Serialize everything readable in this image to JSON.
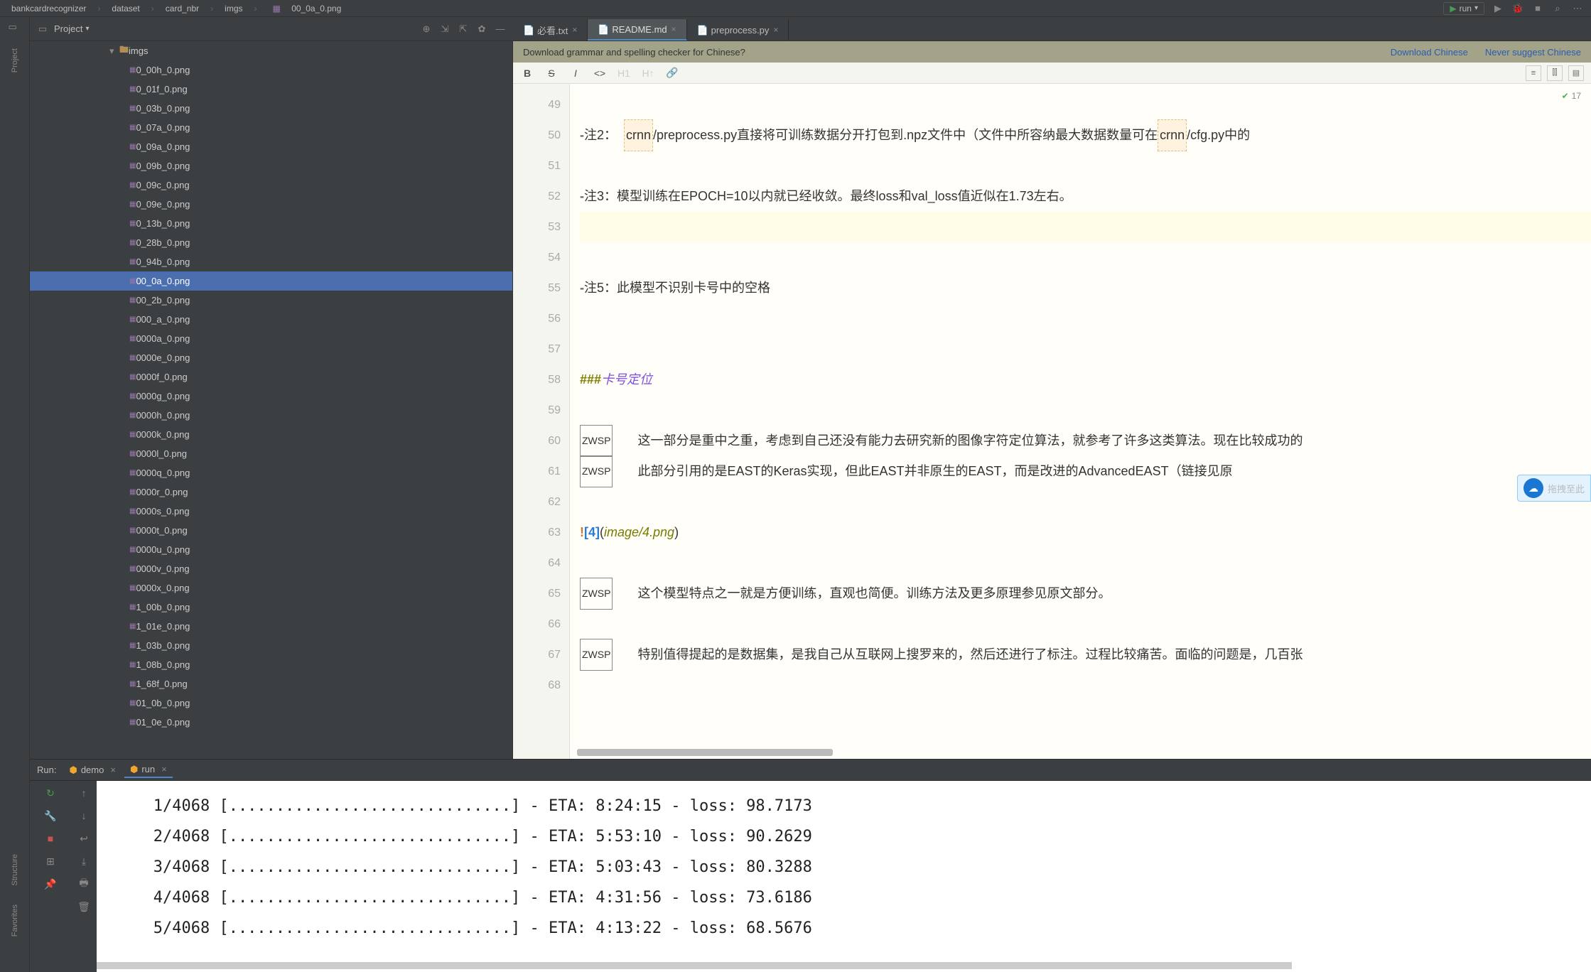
{
  "breadcrumb": [
    "bankcardrecognizer",
    "dataset",
    "card_nbr",
    "imgs",
    "00_0a_0.png"
  ],
  "run_config": "run",
  "project_label": "Project",
  "tree": {
    "folder": "imgs",
    "files": [
      "0_00h_0.png",
      "0_01f_0.png",
      "0_03b_0.png",
      "0_07a_0.png",
      "0_09a_0.png",
      "0_09b_0.png",
      "0_09c_0.png",
      "0_09e_0.png",
      "0_13b_0.png",
      "0_28b_0.png",
      "0_94b_0.png",
      "00_0a_0.png",
      "00_2b_0.png",
      "000_a_0.png",
      "0000a_0.png",
      "0000e_0.png",
      "0000f_0.png",
      "0000g_0.png",
      "0000h_0.png",
      "0000k_0.png",
      "0000l_0.png",
      "0000q_0.png",
      "0000r_0.png",
      "0000s_0.png",
      "0000t_0.png",
      "0000u_0.png",
      "0000v_0.png",
      "0000x_0.png",
      "1_00b_0.png",
      "1_01e_0.png",
      "1_03b_0.png",
      "1_08b_0.png",
      "1_68f_0.png",
      "01_0b_0.png",
      "01_0e_0.png"
    ],
    "selected": "00_0a_0.png"
  },
  "tabs": [
    {
      "label": "必看.txt",
      "active": false
    },
    {
      "label": "README.md",
      "active": true
    },
    {
      "label": "preprocess.py",
      "active": false
    }
  ],
  "banner": {
    "text": "Download grammar and spelling checker for Chinese?",
    "link1": "Download Chinese",
    "link2": "Never suggest Chinese"
  },
  "inspection_count": "17",
  "lines": {
    "start": 49,
    "end": 68,
    "l50_pre": "- 注2：  ",
    "l50_crnn": "crnn",
    "l50_mid": "/preprocess.py直接将可训练数据分开打包到.npz文件中（文件中所容纳最大数据数量可在",
    "l50_crnn2": "crnn",
    "l50_end": "/cfg.py中的",
    "l52": "- 注3：模型训练在EPOCH=10以内就已经收敛。最终loss和val_loss值近似在1.73左右。",
    "l55": "- 注5：此模型不识别卡号中的空格",
    "l58_h": "###",
    "l58_t": " 卡号定位",
    "zwsp": "ZWSP",
    "l60": "这一部分是重中之重，考虑到自己还没有能力去研究新的图像字符定位算法，就参考了许多这类算法。现在比较成功的",
    "l61": "此部分引用的是EAST的Keras实现，但此EAST并非原生的EAST，而是改进的AdvancedEAST（链接见原",
    "l63_bang": "!",
    "l63_bracket": "[4]",
    "l63_paren_open": "(",
    "l63_path": "image/4.png",
    "l63_paren_close": ")",
    "l65": "这个模型特点之一就是方便训练，直观也简便。训练方法及更多原理参见原文部分。",
    "l67": "特别值得提起的是数据集，是我自己从互联网上搜罗来的，然后还进行了标注。过程比较痛苦。面临的问题是，几百张"
  },
  "float_text": "拖拽至此",
  "run": {
    "label": "Run:",
    "tabs": [
      {
        "name": "demo",
        "active": false
      },
      {
        "name": "run",
        "active": true
      }
    ],
    "output": [
      "   1/4068 [..............................] - ETA: 8:24:15 - loss: 98.7173",
      "   2/4068 [..............................] - ETA: 5:53:10 - loss: 90.2629",
      "   3/4068 [..............................] - ETA: 5:03:43 - loss: 80.3288",
      "   4/4068 [..............................] - ETA: 4:31:56 - loss: 73.6186",
      "   5/4068 [..............................] - ETA: 4:13:22 - loss: 68.5676"
    ]
  },
  "side_tabs": {
    "project": "Project",
    "structure": "Structure",
    "favorites": "Favorites"
  }
}
